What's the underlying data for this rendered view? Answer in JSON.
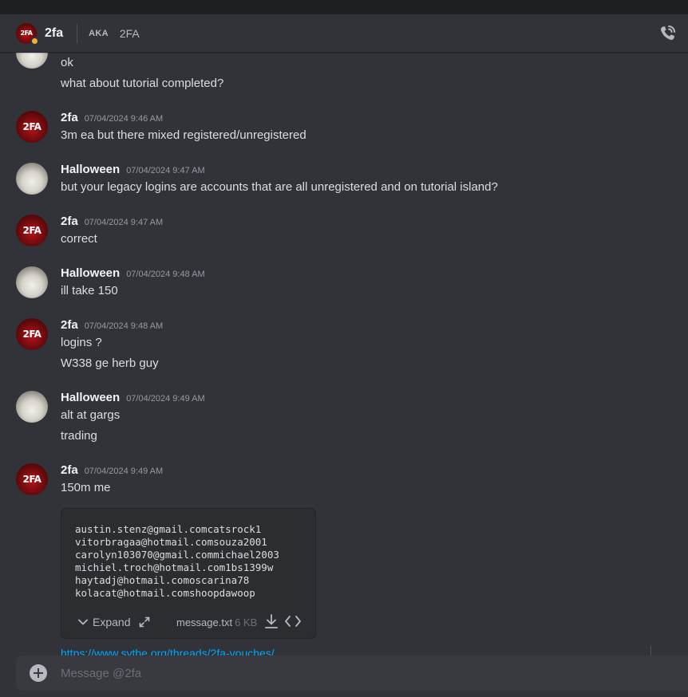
{
  "header": {
    "name": "2fa",
    "avatar_text": "2FA",
    "aka_label": "AKA",
    "aka_name": "2FA"
  },
  "messages": [
    {
      "author": "",
      "timestamp": "",
      "avatar": "cat",
      "lines": [
        "ok",
        "what about tutorial completed?"
      ]
    },
    {
      "author": "2fa",
      "timestamp": "07/04/2024 9:46 AM",
      "avatar": "2fa",
      "lines": [
        "3m ea but there mixed registered/unregistered"
      ]
    },
    {
      "author": "Halloween",
      "timestamp": "07/04/2024 9:47 AM",
      "avatar": "cat",
      "lines": [
        "but your legacy logins are accounts that are all unregistered and on tutorial island?"
      ]
    },
    {
      "author": "2fa",
      "timestamp": "07/04/2024 9:47 AM",
      "avatar": "2fa",
      "lines": [
        "correct"
      ]
    },
    {
      "author": "Halloween",
      "timestamp": "07/04/2024 9:48 AM",
      "avatar": "cat",
      "lines": [
        "ill take 150"
      ]
    },
    {
      "author": "2fa",
      "timestamp": "07/04/2024 9:48 AM",
      "avatar": "2fa",
      "lines": [
        "logins ?",
        "W338 ge herb guy"
      ]
    },
    {
      "author": "Halloween",
      "timestamp": "07/04/2024 9:49 AM",
      "avatar": "cat",
      "lines": [
        "alt at gargs",
        "trading"
      ]
    },
    {
      "author": "2fa",
      "timestamp": "07/04/2024 9:49 AM",
      "avatar": "2fa",
      "lines": [
        "150m me"
      ]
    }
  ],
  "attachment": {
    "lines": [
      "austin.stenz@gmail.comcatsrock1",
      "vitorbragaa@hotmail.comsouza2001",
      "carolyn103070@gmail.commichael2003",
      "michiel.troch@hotmail.com1bs1399w",
      "haytadj@hotmail.comoscarina78",
      "kolacat@hotmail.comshoopdawoop"
    ],
    "expand_label": "Expand",
    "filename": "message.txt",
    "filesize": "6 KB"
  },
  "link_text": "https://www.sythe.org/threads/2fa-vouches/",
  "composer": {
    "placeholder": "Message @2fa"
  },
  "colors": {
    "background": "#313338",
    "link": "#00a8fc",
    "status_idle": "#f0b232"
  }
}
